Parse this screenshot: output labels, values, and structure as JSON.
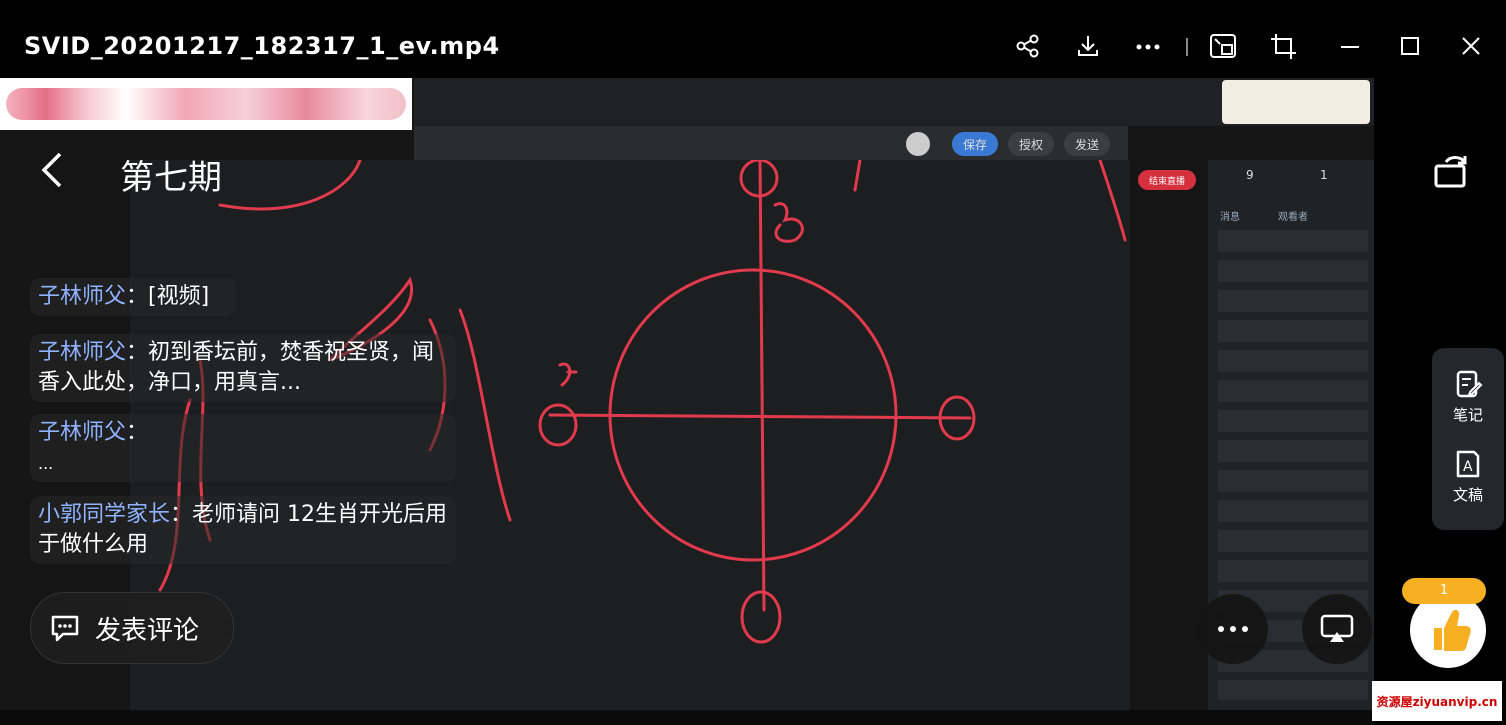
{
  "window": {
    "title": "SVID_20201217_182317_1_ev.mp4",
    "buttons": [
      "share-icon",
      "download-icon",
      "more-icon",
      "picture-in-picture-icon",
      "crop-icon",
      "minimize-icon",
      "maximize-icon",
      "close-icon"
    ]
  },
  "overlay": {
    "episode_title": "第七期",
    "comments": [
      {
        "user": "子林师父",
        "sep": "：",
        "text": "[视频]"
      },
      {
        "user": "子林师父",
        "sep": "：",
        "text": "初到香坛前，焚香祝圣贤，闻香入此处，净口，用真言..."
      },
      {
        "user": "子林师父",
        "sep": "：",
        "text": "..."
      },
      {
        "user": "小郭同学家长",
        "sep": "：",
        "text": "老师请问 12生肖开光后用于做什么用"
      }
    ],
    "post_comment": "发表评论",
    "tools": [
      {
        "label": "笔记"
      },
      {
        "label": "文稿"
      }
    ],
    "like_count": "1"
  },
  "video": {
    "buttons": [
      "保存",
      "授权",
      "发送"
    ],
    "stats": [
      "9",
      "1"
    ],
    "tabs": [
      "消息",
      "观看者"
    ],
    "red_button": "结束直播"
  },
  "watermark": "资源屋ziyuanvip.cn",
  "colors": {
    "accent": "#4a7bd0",
    "comment_user": "#8fb3ff",
    "like": "#f6b022",
    "ink": "#e23a4d"
  }
}
